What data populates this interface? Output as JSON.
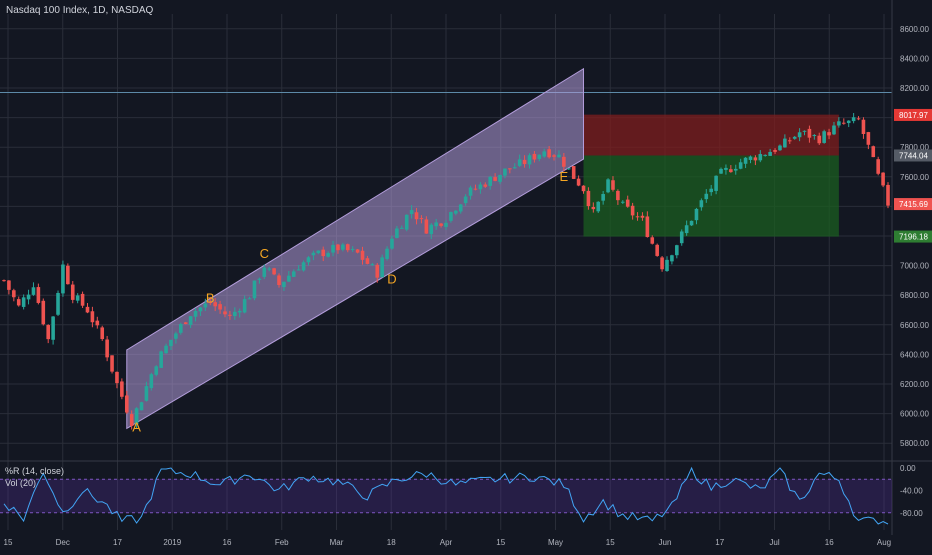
{
  "header": {
    "title": "Nasdaq 100 Index, 1D, NASDAQ"
  },
  "oscillator": {
    "label_wr": "%R (14, close)",
    "label_vol": "Vol (20)",
    "ticks": [
      "0.00",
      "-40.00",
      "-80.00"
    ]
  },
  "colors": {
    "background": "#131722",
    "grid": "#2a2e39",
    "up": "#26a69a",
    "down": "#ef5350",
    "channel": "#b39ddb",
    "label": "#f5a623",
    "target_zone": "#1b5e20",
    "stop_zone": "#7f1d1d",
    "wr_line": "#42a5f5"
  },
  "price_tags": [
    {
      "value": "8017.97",
      "price": 8017.97,
      "color": "#e53935"
    },
    {
      "value": "7744.04",
      "price": 7744.04,
      "color": "#555b66"
    },
    {
      "value": "7415.69",
      "price": 7415.69,
      "color": "#ef5350"
    },
    {
      "value": "7196.18",
      "price": 7196.18,
      "color": "#2e7d32"
    }
  ],
  "chart_data": {
    "type": "candlestick",
    "title": "Nasdaq 100 Index, 1D, NASDAQ",
    "ylim": [
      5700,
      8700
    ],
    "y_ticks": [
      5800,
      6000,
      6200,
      6400,
      6600,
      6800,
      7000,
      7200,
      7400,
      7600,
      7800,
      8000,
      8200,
      8400,
      8600
    ],
    "x_ticks": [
      "15",
      "Dec",
      "17",
      "2019",
      "16",
      "Feb",
      "Mar",
      "18",
      "Apr",
      "15",
      "May",
      "15",
      "Jun",
      "17",
      "Jul",
      "16",
      "Aug"
    ],
    "horizontal_level": 8170,
    "pattern_labels": [
      {
        "text": "A",
        "date_index": 27,
        "price": 5880
      },
      {
        "text": "B",
        "date_index": 42,
        "price": 6750
      },
      {
        "text": "C",
        "date_index": 53,
        "price": 7050
      },
      {
        "text": "D",
        "date_index": 79,
        "price": 6880
      },
      {
        "text": "E",
        "date_index": 114,
        "price": 7570
      }
    ],
    "channel": {
      "start_index": 25,
      "end_index": 118,
      "lower_start": 5900,
      "lower_end": 7720,
      "upper_start": 6430,
      "upper_end": 8330
    },
    "stop_zone": {
      "start_index": 118,
      "end_index": 170,
      "top": 8020,
      "bottom": 7744
    },
    "target_zone": {
      "start_index": 118,
      "end_index": 170,
      "top": 7744,
      "bottom": 7196
    },
    "anchors": [
      [
        0,
        6900
      ],
      [
        3,
        6720
      ],
      [
        6,
        6880
      ],
      [
        9,
        6500
      ],
      [
        12,
        7000
      ],
      [
        14,
        6800
      ],
      [
        17,
        6700
      ],
      [
        20,
        6500
      ],
      [
        23,
        6200
      ],
      [
        26,
        5950
      ],
      [
        28,
        6100
      ],
      [
        31,
        6350
      ],
      [
        34,
        6500
      ],
      [
        38,
        6680
      ],
      [
        42,
        6750
      ],
      [
        46,
        6650
      ],
      [
        50,
        6800
      ],
      [
        53,
        7000
      ],
      [
        56,
        6870
      ],
      [
        60,
        7000
      ],
      [
        64,
        7080
      ],
      [
        68,
        7120
      ],
      [
        72,
        7080
      ],
      [
        76,
        6950
      ],
      [
        79,
        7200
      ],
      [
        83,
        7380
      ],
      [
        86,
        7250
      ],
      [
        90,
        7320
      ],
      [
        94,
        7480
      ],
      [
        98,
        7560
      ],
      [
        102,
        7640
      ],
      [
        106,
        7700
      ],
      [
        110,
        7780
      ],
      [
        113,
        7740
      ],
      [
        116,
        7600
      ],
      [
        118,
        7520
      ],
      [
        120,
        7350
      ],
      [
        123,
        7550
      ],
      [
        126,
        7400
      ],
      [
        130,
        7300
      ],
      [
        134,
        7000
      ],
      [
        137,
        7150
      ],
      [
        140,
        7320
      ],
      [
        143,
        7480
      ],
      [
        146,
        7620
      ],
      [
        150,
        7700
      ],
      [
        154,
        7750
      ],
      [
        158,
        7800
      ],
      [
        162,
        7900
      ],
      [
        166,
        7860
      ],
      [
        170,
        7950
      ],
      [
        174,
        7980
      ],
      [
        176,
        7800
      ],
      [
        178,
        7600
      ],
      [
        180,
        7420
      ]
    ],
    "wr_anchors": [
      [
        0,
        -60
      ],
      [
        4,
        -90
      ],
      [
        8,
        -5
      ],
      [
        12,
        -80
      ],
      [
        16,
        -40
      ],
      [
        20,
        -60
      ],
      [
        24,
        -95
      ],
      [
        28,
        -90
      ],
      [
        32,
        -5
      ],
      [
        38,
        -10
      ],
      [
        44,
        -30
      ],
      [
        50,
        -10
      ],
      [
        56,
        -40
      ],
      [
        62,
        -15
      ],
      [
        68,
        -25
      ],
      [
        74,
        -50
      ],
      [
        80,
        -20
      ],
      [
        86,
        -10
      ],
      [
        92,
        -30
      ],
      [
        100,
        -20
      ],
      [
        108,
        -15
      ],
      [
        114,
        -30
      ],
      [
        118,
        -90
      ],
      [
        122,
        -60
      ],
      [
        126,
        -85
      ],
      [
        132,
        -95
      ],
      [
        136,
        -70
      ],
      [
        140,
        -5
      ],
      [
        144,
        -35
      ],
      [
        148,
        -20
      ],
      [
        154,
        -40
      ],
      [
        158,
        -5
      ],
      [
        162,
        -60
      ],
      [
        166,
        -10
      ],
      [
        170,
        -20
      ],
      [
        174,
        -95
      ],
      [
        180,
        -95
      ]
    ]
  }
}
